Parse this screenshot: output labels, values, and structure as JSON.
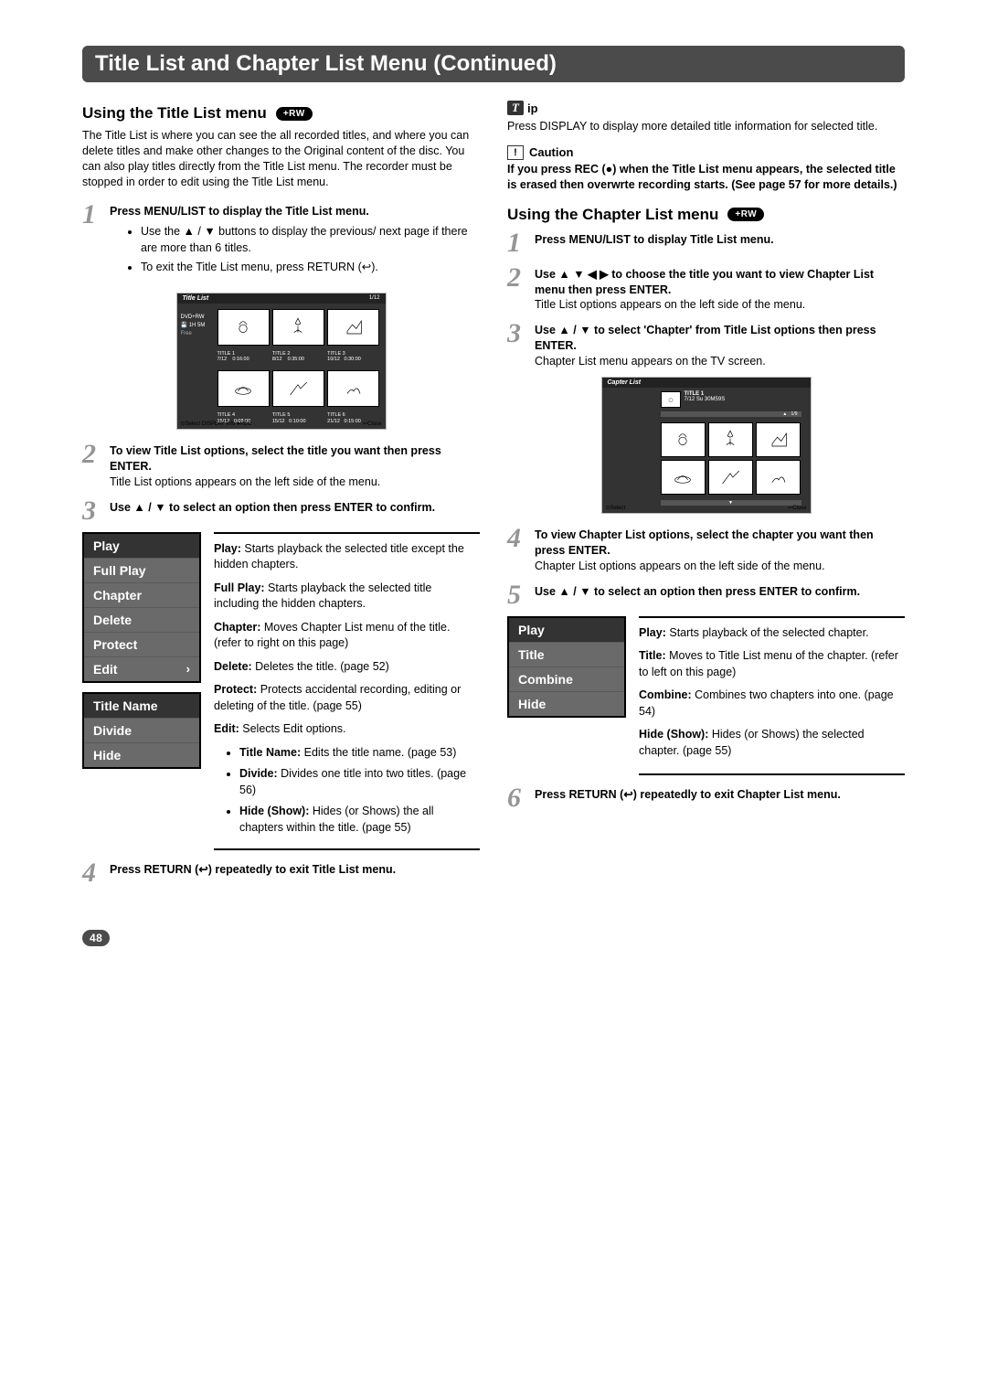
{
  "page_title": "Title List and Chapter List Menu (Continued)",
  "page_number": "48",
  "badges": {
    "rw": "+RW"
  },
  "left": {
    "heading": "Using the Title List menu",
    "intro": "The Title List is where you can see the all recorded titles, and where you can delete titles and make other changes to the Original content of the disc. You can also play titles directly from the Title List menu. The recorder must be stopped in order to edit using the Title List menu.",
    "step1_bold": "Press MENU/LIST to display the Title List menu.",
    "step1_b1": "Use the ▲ / ▼ buttons to display the previous/ next page if there are more than 6 titles.",
    "step1_b2": "To exit the Title List menu, press RETURN (↩).",
    "tl_shot": {
      "header": "Title List",
      "count": "1/12",
      "side1": "DVD+RW",
      "side2": "1H 5M",
      "side3": "Free",
      "row1": [
        "TITLE 1\n7/12    0:16:00",
        "TITLE 2\n8/12    0:35:00",
        "TITLE 3\n10/12   0:30:00"
      ],
      "row2": [
        "TITLE 4\n15/12   0:08:00",
        "TITLE 5\n15/12   0:10:00",
        "TITLE 6\n21/12   0:15:00"
      ],
      "footer_l": "⊙Select    DISPLAY Info    ●REC",
      "footer_r": "↩Close"
    },
    "step2_bold": "To view Title List options, select the title you want then press ENTER.",
    "step2_text": "Title List options appears on the left side of the menu.",
    "step3_bold": "Use ▲ / ▼ to select an option then press ENTER to confirm.",
    "options1": [
      "Play",
      "Full Play",
      "Chapter",
      "Delete",
      "Protect",
      "Edit"
    ],
    "options2": [
      "Title Name",
      "Divide",
      "Hide"
    ],
    "desc": {
      "play": "Play: ",
      "play_t": "Starts playback the selected title except the hidden chapters.",
      "full": "Full Play: ",
      "full_t": "Starts playback the selected title including the hidden chapters.",
      "chapter": "Chapter: ",
      "chapter_t": "Moves Chapter List menu of the title. (refer to right on this page)",
      "delete": "Delete: ",
      "delete_t": "Deletes the title. (page 52)",
      "protect": "Protect: ",
      "protect_t": "Protects accidental recording, editing or deleting of the title. (page 55)",
      "edit": "Edit: ",
      "edit_t": "Selects Edit options.",
      "tname": "Title Name: ",
      "tname_t": "Edits the title name. (page 53)",
      "divide": "Divide: ",
      "divide_t": "Divides one title into two titles. (page 56)",
      "hide": "Hide (Show): ",
      "hide_t": "Hides (or Shows) the all chapters within the title. (page 55)"
    },
    "step4_bold": "Press RETURN (↩) repeatedly to exit Title List menu."
  },
  "right": {
    "tip_label": "ip",
    "tip_text": "Press DISPLAY to display more detailed title information for selected title.",
    "caution_label": "Caution",
    "caution_text": "If you press REC (●) when the Title List menu appears, the selected title is erased then overwrte recording starts. (See page 57 for more details.)",
    "heading": "Using the Chapter List menu",
    "step1_bold": "Press MENU/LIST to display Title List menu.",
    "step2_bold": "Use ▲ ▼ ◀ ▶ to choose the title you want to view Chapter List menu then press ENTER.",
    "step2_text": "Title List options appears on the left side of the menu.",
    "step3_bold": "Use ▲ / ▼ to select 'Chapter' from Title List options then press ENTER.",
    "step3_text": "Chapter List menu appears on the TV screen.",
    "cl_shot": {
      "header": "Capter List",
      "title": "TITLE 1",
      "sub": "7/12 Su   30M59S",
      "count": "1/9",
      "footer_l": "⊙Select",
      "footer_r": "↩Close"
    },
    "step4_bold": "To view Chapter List options, select the chapter you want then press ENTER.",
    "step4_text": "Chapter List options appears on the left side of the menu.",
    "step5_bold": "Use ▲ / ▼ to select an option then press ENTER to confirm.",
    "options": [
      "Play",
      "Title",
      "Combine",
      "Hide"
    ],
    "desc": {
      "play": "Play: ",
      "play_t": "Starts playback of the selected chapter.",
      "title": "Title: ",
      "title_t": "Moves to Title List menu of the chapter. (refer to left on this page)",
      "combine": "Combine: ",
      "combine_t": "Combines two chapters into one. (page 54)",
      "hide": "Hide (Show): ",
      "hide_t": "Hides (or Shows) the selected chapter. (page 55)"
    },
    "step6_bold": "Press RETURN (↩) repeatedly to exit Chapter List menu."
  }
}
